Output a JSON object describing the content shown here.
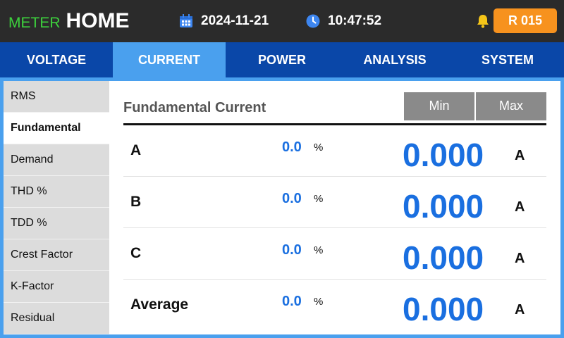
{
  "header": {
    "brand_prefix": "METER",
    "brand_title": "HOME",
    "date": "2024-11-21",
    "time": "10:47:52",
    "alarm_label": "R 015"
  },
  "nav": {
    "tabs": [
      {
        "label": "VOLTAGE",
        "active": false
      },
      {
        "label": "CURRENT",
        "active": true
      },
      {
        "label": "POWER",
        "active": false
      },
      {
        "label": "ANALYSIS",
        "active": false
      },
      {
        "label": "SYSTEM",
        "active": false
      }
    ]
  },
  "sidebar": {
    "items": [
      {
        "label": "RMS",
        "active": false
      },
      {
        "label": "Fundamental",
        "active": true
      },
      {
        "label": "Demand",
        "active": false
      },
      {
        "label": "THD %",
        "active": false
      },
      {
        "label": "TDD %",
        "active": false
      },
      {
        "label": "Crest Factor",
        "active": false
      },
      {
        "label": "K-Factor",
        "active": false
      },
      {
        "label": "Residual",
        "active": false
      }
    ]
  },
  "main": {
    "title": "Fundamental Current",
    "min_label": "Min",
    "max_label": "Max",
    "rows": [
      {
        "label": "A",
        "pct": "0.0",
        "pct_unit": "%",
        "value": "0.000",
        "unit": "A"
      },
      {
        "label": "B",
        "pct": "0.0",
        "pct_unit": "%",
        "value": "0.000",
        "unit": "A"
      },
      {
        "label": "C",
        "pct": "0.0",
        "pct_unit": "%",
        "value": "0.000",
        "unit": "A"
      },
      {
        "label": "Average",
        "pct": "0.0",
        "pct_unit": "%",
        "value": "0.000",
        "unit": "A"
      }
    ]
  },
  "colors": {
    "topbar": "#2b2b2b",
    "brand_accent": "#3dd13d",
    "nav": "#0a47a8",
    "active_tab": "#4aa0ee",
    "alarm": "#f7921e",
    "value_blue": "#1a6fe0",
    "sidebar_bg": "#dcdcdc",
    "minmax_btn": "#8a8a8a"
  },
  "icons": {
    "date": "calendar-icon",
    "time": "clock-icon",
    "alarm": "bell-icon"
  }
}
